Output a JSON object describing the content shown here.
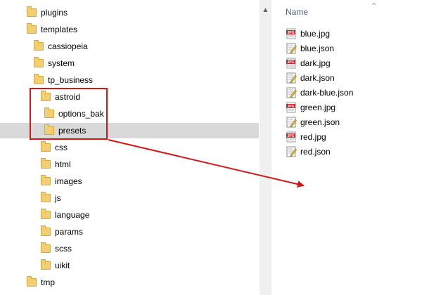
{
  "tree": {
    "items": [
      {
        "label": "plugins",
        "depth": 0
      },
      {
        "label": "templates",
        "depth": 0
      },
      {
        "label": "cassiopeia",
        "depth": 1
      },
      {
        "label": "system",
        "depth": 1
      },
      {
        "label": "tp_business",
        "depth": 1
      },
      {
        "label": "astroid",
        "depth": 2
      },
      {
        "label": "options_bak",
        "depth": 3
      },
      {
        "label": "presets",
        "depth": 3,
        "selected": true
      },
      {
        "label": "css",
        "depth": 2
      },
      {
        "label": "html",
        "depth": 2
      },
      {
        "label": "images",
        "depth": 2
      },
      {
        "label": "js",
        "depth": 2
      },
      {
        "label": "language",
        "depth": 2
      },
      {
        "label": "params",
        "depth": 2
      },
      {
        "label": "scss",
        "depth": 2
      },
      {
        "label": "uikit",
        "depth": 2
      },
      {
        "label": "tmp",
        "depth": 0
      }
    ]
  },
  "file_list": {
    "column_header": "Name",
    "files": [
      {
        "name": "blue.jpg",
        "icon": "jpg-file-icon"
      },
      {
        "name": "blue.json",
        "icon": "json-file-icon"
      },
      {
        "name": "dark.jpg",
        "icon": "jpg-file-icon"
      },
      {
        "name": "dark.json",
        "icon": "json-file-icon"
      },
      {
        "name": "dark-blue.json",
        "icon": "json-file-icon"
      },
      {
        "name": "green.jpg",
        "icon": "jpg-file-icon"
      },
      {
        "name": "green.json",
        "icon": "json-file-icon"
      },
      {
        "name": "red.jpg",
        "icon": "jpg-file-icon"
      },
      {
        "name": "red.json",
        "icon": "json-file-icon"
      }
    ]
  },
  "colors": {
    "annotation": "#d01818",
    "selected_row": "#d9d9d9",
    "folder": "#f3cf73",
    "header_text": "#4d6185"
  }
}
